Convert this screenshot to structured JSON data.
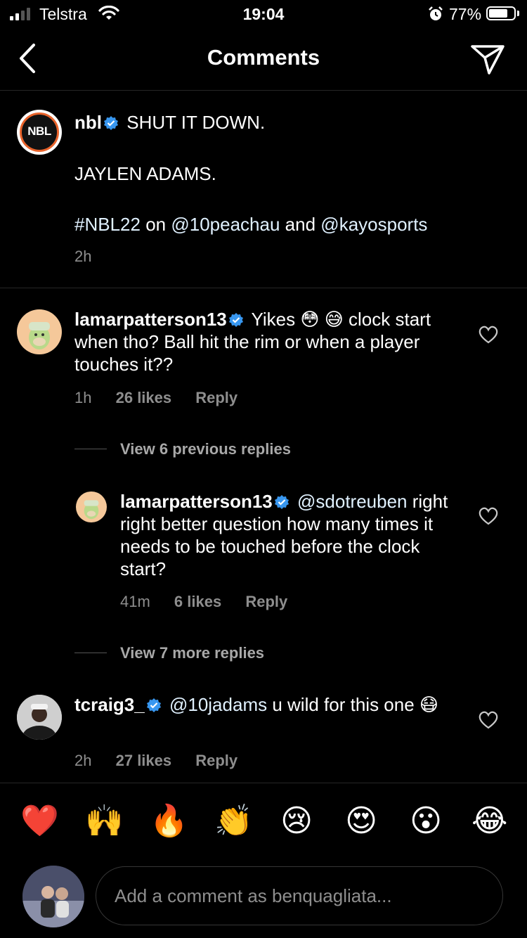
{
  "status_bar": {
    "carrier": "Telstra",
    "time": "19:04",
    "battery": "77%",
    "battery_level": 0.77
  },
  "header": {
    "title": "Comments"
  },
  "caption": {
    "username": "nbl",
    "avatar_text": "NBL",
    "line1": "SHUT IT DOWN.",
    "line2": "JAYLEN ADAMS.",
    "hashtag": "#NBL22",
    "on_text": "on",
    "mention1": "@10peachau",
    "and_text": "and",
    "mention2": "@kayosports",
    "time": "2h"
  },
  "comments": [
    {
      "username": "lamarpatterson13",
      "text": "Yikes 😳 😅 clock start when tho? Ball hit the rim or when a player touches it??",
      "time": "1h",
      "likes": "26 likes",
      "reply": "Reply"
    },
    {
      "username": "tcraig3_",
      "mention": "@10jadams",
      "text": "u wild for this one 😷",
      "time": "2h",
      "likes": "27 likes",
      "reply": "Reply"
    }
  ],
  "replies": {
    "view_previous": "View 6 previous replies",
    "view_more": "View 7 more replies",
    "reply1": {
      "username": "lamarpatterson13",
      "mention": "@sdotreuben",
      "text": "right right better question how many times it needs to be touched before the clock start?",
      "time": "41m",
      "likes": "6 likes",
      "reply": "Reply"
    }
  },
  "emoji_bar": [
    "❤️",
    "🙌",
    "🔥",
    "👏",
    "😢",
    "😍",
    "😮",
    "😂"
  ],
  "input": {
    "placeholder": "Add a comment as benquagliata..."
  },
  "colors": {
    "background": "#000000",
    "verified": "#3897f0",
    "secondary_text": "#8e8e8e"
  }
}
